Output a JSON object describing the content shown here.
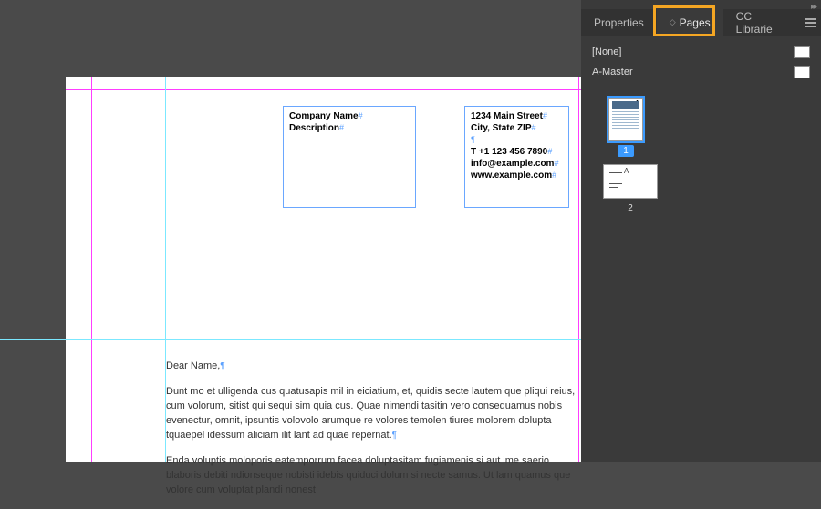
{
  "tabs": {
    "properties": "Properties",
    "pages": "Pages",
    "libraries": "CC Librarie"
  },
  "masters": {
    "none": "[None]",
    "amaster": "A-Master"
  },
  "thumbs": {
    "page1": "1",
    "page2": "2",
    "spreadLabel": "A"
  },
  "frame1": {
    "line1": "Company Name",
    "line2": "Description"
  },
  "frame2": {
    "line1": "1234 Main Street",
    "line2": "City, State ZIP",
    "line3": "T +1 123 456 7890",
    "line4": "info@example.com",
    "line5": "www.example.com"
  },
  "body": {
    "greeting": "Dear Name,",
    "p1": "Dunt mo et ulligenda cus quatusapis mil in eiciatium, et, quidis secte lautem que pliqui reius, cum volorum, sitist qui sequi sim quia cus. Quae nimendi tasitin vero consequamus nobis evenectur, omnit, ipsuntis volovolo arumque re volores temolen tiures molorem dolupta tquaepel idessum aliciam ilit lant ad quae repernat.",
    "p2": "Enda voluptis moloporis eatemporrum facea doluptasitam fugiamenis si aut ime saerio blaboris debiti ndionseque nobisti idebis quiduci dolum si necte samus. Ut lam quamus que volore cum voluptat plandi nonest"
  }
}
